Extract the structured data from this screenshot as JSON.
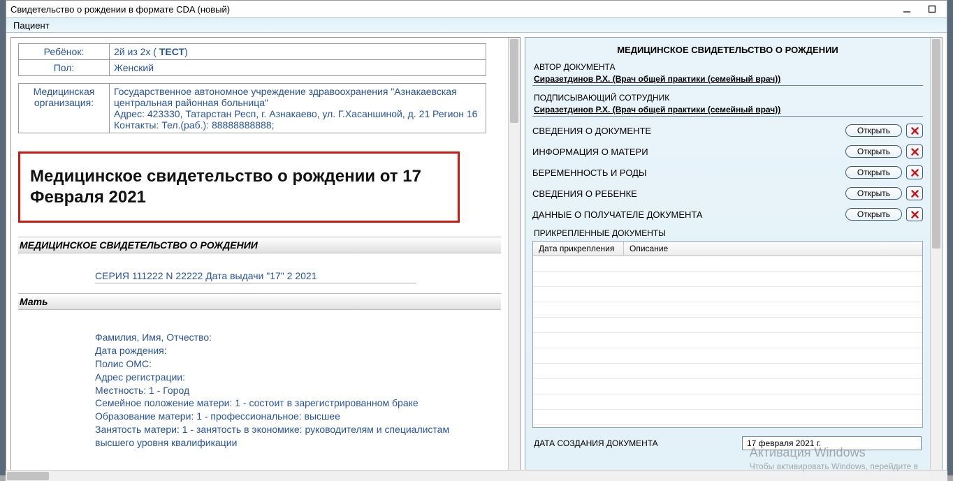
{
  "window": {
    "title": "Свидетельство о рождении в формате CDA (новый)"
  },
  "patient_strip": {
    "label": "Пациент",
    "value": ""
  },
  "left": {
    "tbl1": {
      "child_lbl": "Ребёнок:",
      "child_val_prefix": "2й из 2х ( ",
      "child_val_bold": "ТЕСТ",
      "child_val_suffix": ")",
      "sex_lbl": "Пол:",
      "sex_val": "Женский"
    },
    "tbl2": {
      "org_lbl": "Медицинская организация:",
      "org_name": "Государственное автономное учреждение здравоохранения \"Азнакаевская центральная районная больница\"",
      "org_addr": "Адрес: 423330, Татарстан Респ, г. Азнакаево, ул. Г.Хасаншиной, д. 21 Регион 16",
      "org_contacts": "Контакты: Тел.(раб.): 88888888888;"
    },
    "heading": "Медицинское свидетельство о рождении от 17 Февраля 2021",
    "section1": "МЕДИЦИНСКОЕ СВИДЕТЕЛЬСТВО О РОЖДЕНИИ",
    "series_line": "СЕРИЯ 111222 N 22222 Дата выдачи \"17\" 2 2021",
    "section2": "Мать",
    "mother": {
      "l1": "Фамилия, Имя, Отчество:",
      "l2": "Дата рождения:",
      "l3": "Полис ОМС:",
      "l4": "Адрес регистрации:",
      "l5": "Местность: 1 - Город",
      "l6": "Семейное положение матери: 1 - состоит в зарегистрированном браке",
      "l7": "Образование матери: 1 - профессиональное: высшее",
      "l8": "Занятость матери: 1 - занятость в экономике: руководителям и специалистам высшего уровня квалификации"
    }
  },
  "right": {
    "title": "МЕДИЦИНСКОЕ СВИДЕТЕЛЬСТВО О РОЖДЕНИИ",
    "author_lbl": "АВТОР ДОКУМЕНТА",
    "author_val": "Сиразетдинов Р.Х. (Врач общей практики (семейный врач))",
    "signer_lbl": "ПОДПИСЫВАЮЩИЙ СОТРУДНИК",
    "signer_val": "Сиразетдинов Р.Х. (Врач общей практики (семейный врач))",
    "rows": [
      "СВЕДЕНИЯ О ДОКУМЕНТЕ",
      "ИНФОРМАЦИЯ О МАТЕРИ",
      "БЕРЕМЕННОСТЬ И РОДЫ",
      "СВЕДЕНИЯ О РЕБЕНКЕ",
      "ДАННЫЕ О ПОЛУЧАТЕЛЕ ДОКУМЕНТА"
    ],
    "open_btn": "Открыть",
    "attach_lbl": "ПРИКРЕПЛЕННЫЕ ДОКУМЕНТЫ",
    "grid": {
      "col1": "Дата прикрепления",
      "col2": "Описание"
    },
    "date_lbl": "ДАТА СОЗДАНИЯ ДОКУМЕНТА",
    "date_val": "17 февраля  2021 г."
  },
  "watermark": {
    "l1": "Активация Windows",
    "l2": "Чтобы активировать Windows, перейдите в"
  }
}
